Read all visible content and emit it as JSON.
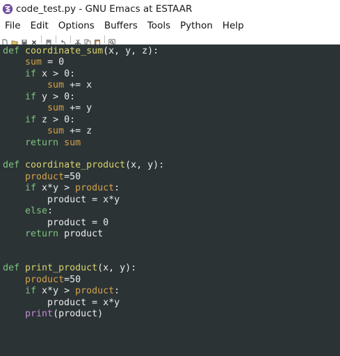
{
  "window": {
    "title": "code_test.py - GNU Emacs at ESTAAR"
  },
  "menubar": {
    "items": [
      "File",
      "Edit",
      "Options",
      "Buffers",
      "Tools",
      "Python",
      "Help"
    ]
  },
  "toolbar": {
    "icons": [
      "new-file-icon",
      "open-folder-icon",
      "save-icon",
      "close-icon",
      "save-as-icon",
      "undo-icon",
      "cut-icon",
      "copy-icon",
      "paste-icon",
      "search-icon"
    ]
  },
  "colors": {
    "editor_bg": "#2b3335",
    "keyword": "#7fc37f",
    "function_name": "#d9d36e",
    "variable": "#d4a24a",
    "builtin": "#c58ad6",
    "text": "#ececec"
  },
  "code_lines": [
    [
      {
        "t": "def",
        "c": "kw"
      },
      {
        "t": " "
      },
      {
        "t": "coordinate_sum",
        "c": "fn"
      },
      {
        "t": "(x, y, z):"
      }
    ],
    [
      {
        "t": "    "
      },
      {
        "t": "sum",
        "c": "var"
      },
      {
        "t": " = 0"
      }
    ],
    [
      {
        "t": "    "
      },
      {
        "t": "if",
        "c": "kw"
      },
      {
        "t": " x > 0:"
      }
    ],
    [
      {
        "t": "        "
      },
      {
        "t": "sum",
        "c": "var"
      },
      {
        "t": " += x"
      }
    ],
    [
      {
        "t": "    "
      },
      {
        "t": "if",
        "c": "kw"
      },
      {
        "t": " y > 0:"
      }
    ],
    [
      {
        "t": "        "
      },
      {
        "t": "sum",
        "c": "var"
      },
      {
        "t": " += y"
      }
    ],
    [
      {
        "t": "    "
      },
      {
        "t": "if",
        "c": "kw"
      },
      {
        "t": " z > 0:"
      }
    ],
    [
      {
        "t": "        "
      },
      {
        "t": "sum",
        "c": "var"
      },
      {
        "t": " += z"
      }
    ],
    [
      {
        "t": "    "
      },
      {
        "t": "return",
        "c": "kw"
      },
      {
        "t": " "
      },
      {
        "t": "sum",
        "c": "var"
      }
    ],
    [],
    [
      {
        "t": "def",
        "c": "kw"
      },
      {
        "t": " "
      },
      {
        "t": "coordinate_product",
        "c": "fn"
      },
      {
        "t": "(x, y):"
      }
    ],
    [
      {
        "t": "    "
      },
      {
        "t": "product",
        "c": "var"
      },
      {
        "t": "=50"
      }
    ],
    [
      {
        "t": "    "
      },
      {
        "t": "if",
        "c": "kw"
      },
      {
        "t": " x*y > "
      },
      {
        "t": "product",
        "c": "var"
      },
      {
        "t": ":"
      }
    ],
    [
      {
        "t": "        product = x*y"
      }
    ],
    [
      {
        "t": "    "
      },
      {
        "t": "else",
        "c": "kw"
      },
      {
        "t": ":"
      }
    ],
    [
      {
        "t": "        product = 0"
      }
    ],
    [
      {
        "t": "    "
      },
      {
        "t": "return",
        "c": "kw"
      },
      {
        "t": " product"
      }
    ],
    [],
    [],
    [
      {
        "t": "def",
        "c": "kw"
      },
      {
        "t": " "
      },
      {
        "t": "print_product",
        "c": "fn"
      },
      {
        "t": "(x, y):"
      }
    ],
    [
      {
        "t": "    "
      },
      {
        "t": "product",
        "c": "var"
      },
      {
        "t": "=50"
      }
    ],
    [
      {
        "t": "    "
      },
      {
        "t": "if",
        "c": "kw"
      },
      {
        "t": " x*y > "
      },
      {
        "t": "product",
        "c": "var"
      },
      {
        "t": ":"
      }
    ],
    [
      {
        "t": "        product = x*y"
      }
    ],
    [
      {
        "t": "    "
      },
      {
        "t": "print",
        "c": "bi"
      },
      {
        "t": "(product)"
      }
    ]
  ]
}
